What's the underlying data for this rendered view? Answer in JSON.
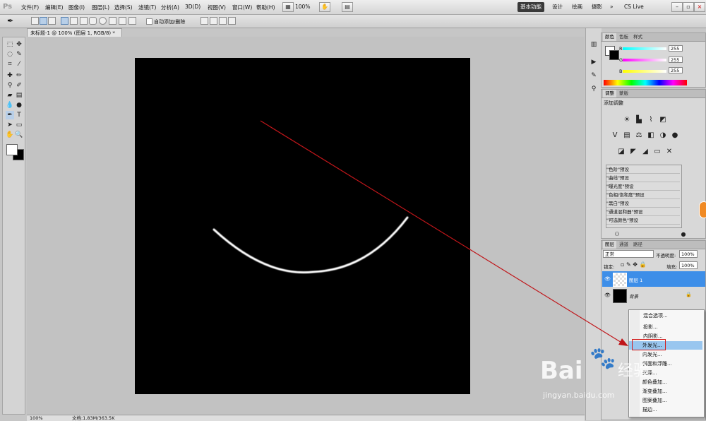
{
  "menubar": {
    "logo": "Ps",
    "items": [
      "文件(F)",
      "编辑(E)",
      "图像(I)",
      "图层(L)",
      "选择(S)",
      "滤镜(T)",
      "分析(A)",
      "3D(D)",
      "视图(V)",
      "窗口(W)",
      "帮助(H)"
    ],
    "zoom": "100%",
    "workspaces": [
      "基本功能",
      "设计",
      "绘画",
      "摄影"
    ],
    "cslive": "CS Live"
  },
  "options": {
    "auto_add_delete": "自动添加/删除"
  },
  "document": {
    "tab_title": "未标题-1 @ 100% (图层 1, RGB/8) *"
  },
  "status": {
    "zoom": "100%",
    "doc_info": "文档:1.83M/363.5K"
  },
  "color_panel": {
    "tabs": [
      "颜色",
      "色板",
      "样式"
    ],
    "channels": [
      {
        "label": "R",
        "value": "255"
      },
      {
        "label": "G",
        "value": "255"
      },
      {
        "label": "B",
        "value": "255"
      }
    ]
  },
  "adjust_panel": {
    "tabs": [
      "调整",
      "蒙版"
    ],
    "title": "添加调整",
    "presets": [
      "\"色阶\"预设",
      "\"曲线\"预设",
      "\"曝光度\"预设",
      "\"色相/饱和度\"预设",
      "\"黑白\"预设",
      "\"通道混和器\"预设",
      "\"可选颜色\"预设"
    ]
  },
  "layers_panel": {
    "tabs": [
      "图层",
      "通道",
      "路径"
    ],
    "blend_mode": "正常",
    "opacity_label": "不透明度:",
    "opacity": "100%",
    "lock_label": "锁定:",
    "fill_label": "填充:",
    "fill": "100%",
    "layers": [
      {
        "name": "图层 1",
        "selected": true
      },
      {
        "name": "背景",
        "selected": false
      }
    ]
  },
  "context_menu": {
    "items": [
      "混合选项...",
      "投影...",
      "内阴影...",
      "外发光...",
      "内发光...",
      "斜面和浮雕...",
      "光泽...",
      "颜色叠加...",
      "渐变叠加...",
      "图案叠加...",
      "描边..."
    ],
    "highlighted": "外发光..."
  },
  "watermark": {
    "brand": "Bai",
    "brand_cn": "经验",
    "url": "jingyan.baidu.com"
  },
  "colors": {
    "annotation_red": "#c0161a",
    "highlight_blue": "#99c6ef",
    "layer_selected": "#3d8ee8"
  }
}
